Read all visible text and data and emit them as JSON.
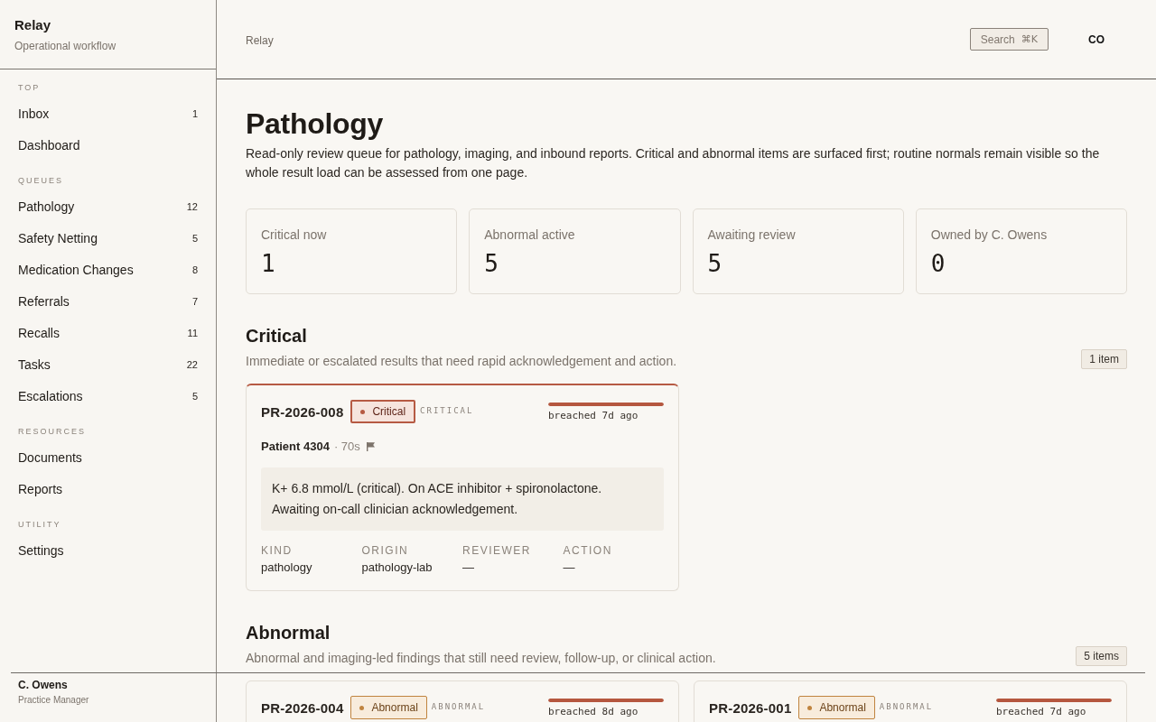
{
  "sidebar": {
    "brand": {
      "title": "Relay",
      "subtitle": "Operational workflow"
    },
    "sections": [
      {
        "heading": "TOP",
        "items": [
          {
            "label": "Inbox",
            "count": "1"
          },
          {
            "label": "Dashboard"
          }
        ]
      },
      {
        "heading": "QUEUES",
        "items": [
          {
            "label": "Pathology",
            "count": "12"
          },
          {
            "label": "Safety Netting",
            "count": "5"
          },
          {
            "label": "Medication Changes",
            "count": "8"
          },
          {
            "label": "Referrals",
            "count": "7"
          },
          {
            "label": "Recalls",
            "count": "11"
          },
          {
            "label": "Tasks",
            "count": "22"
          },
          {
            "label": "Escalations",
            "count": "5"
          }
        ]
      },
      {
        "heading": "RESOURCES",
        "items": [
          {
            "label": "Documents"
          },
          {
            "label": "Reports"
          }
        ]
      },
      {
        "heading": "UTILITY",
        "items": [
          {
            "label": "Settings"
          }
        ]
      }
    ],
    "user": {
      "name": "C. Owens",
      "role": "Practice Manager"
    }
  },
  "header": {
    "breadcrumb": "Relay",
    "search": {
      "label": "Search",
      "shortcut": "⌘K"
    },
    "user_initials": "CO"
  },
  "page": {
    "title": "Pathology",
    "description": "Read-only review queue for pathology, imaging, and inbound reports. Critical and abnormal items are surfaced first; routine normals remain visible so the whole result load can be assessed from one page."
  },
  "stats": [
    {
      "label": "Critical now",
      "value": "1"
    },
    {
      "label": "Abnormal active",
      "value": "5"
    },
    {
      "label": "Awaiting review",
      "value": "5"
    },
    {
      "label": "Owned by C. Owens",
      "value": "0"
    }
  ],
  "groups": [
    {
      "title": "Critical",
      "description": "Immediate or escalated results that need rapid acknowledgement and action.",
      "count": "1 item",
      "cards": [
        {
          "id": "PR-2026-008",
          "kind": "critical",
          "badge": "Critical",
          "tag": "CRITICAL",
          "sla": {
            "level": 1,
            "text": "breached 7d ago"
          },
          "patient": "Patient 4304",
          "age": "· 70s",
          "flagged": true,
          "note": "K+ 6.8 mmol/L (critical). On ACE inhibitor + spironolactone. Awaiting on-call clinician acknowledgement.",
          "fields": [
            {
              "label": "KIND",
              "value": "pathology"
            },
            {
              "label": "ORIGIN",
              "value": "pathology-lab"
            },
            {
              "label": "REVIEWER",
              "value": "—"
            },
            {
              "label": "ACTION",
              "value": "—"
            }
          ]
        }
      ]
    },
    {
      "title": "Abnormal",
      "description": "Abnormal and imaging-led findings that still need review, follow-up, or clinical action.",
      "count": "5 items",
      "cards": [
        {
          "id": "PR-2026-004",
          "kind": "abnormal",
          "badge": "Abnormal",
          "tag": "ABNORMAL",
          "sla": {
            "level": 1,
            "text": "breached 8d ago"
          }
        },
        {
          "id": "PR-2026-001",
          "kind": "abnormal",
          "badge": "Abnormal",
          "tag": "ABNORMAL",
          "sla": {
            "level": 1,
            "text": "breached 7d ago"
          }
        }
      ]
    }
  ]
}
